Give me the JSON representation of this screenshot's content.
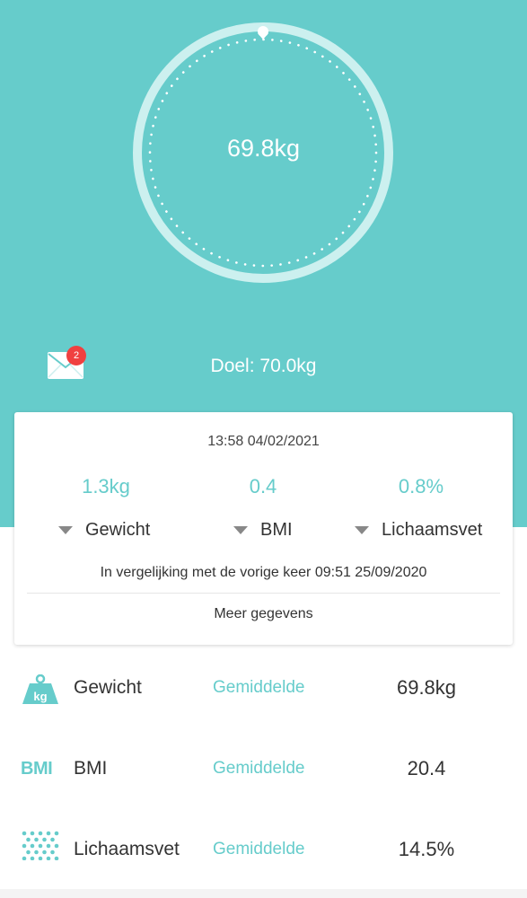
{
  "gauge": {
    "weight": "69.8kg"
  },
  "notifications": {
    "icon": "mail-icon",
    "count": "2"
  },
  "goal": "Doel: 70.0kg",
  "card": {
    "timestamp": "13:58 04/02/2021",
    "deltas": [
      {
        "value": "1.3kg",
        "label": "Gewicht"
      },
      {
        "value": "0.4",
        "label": "BMI"
      },
      {
        "value": "0.8%",
        "label": "Lichaamsvet"
      }
    ],
    "comparison": "In vergelijking met de vorige keer 09:51 25/09/2020",
    "more_label": "Meer gegevens"
  },
  "metrics": [
    {
      "icon": "weight-icon",
      "icon_text": "kg",
      "label": "Gewicht",
      "status": "Gemiddelde",
      "value": "69.8kg"
    },
    {
      "icon": "bmi-icon",
      "icon_text": "BMI",
      "label": "BMI",
      "status": "Gemiddelde",
      "value": "20.4"
    },
    {
      "icon": "body-fat-icon",
      "label": "Lichaamsvet",
      "status": "Gemiddelde",
      "value": "14.5%"
    }
  ],
  "colors": {
    "accent": "#66cccb",
    "badge": "#f04040"
  }
}
